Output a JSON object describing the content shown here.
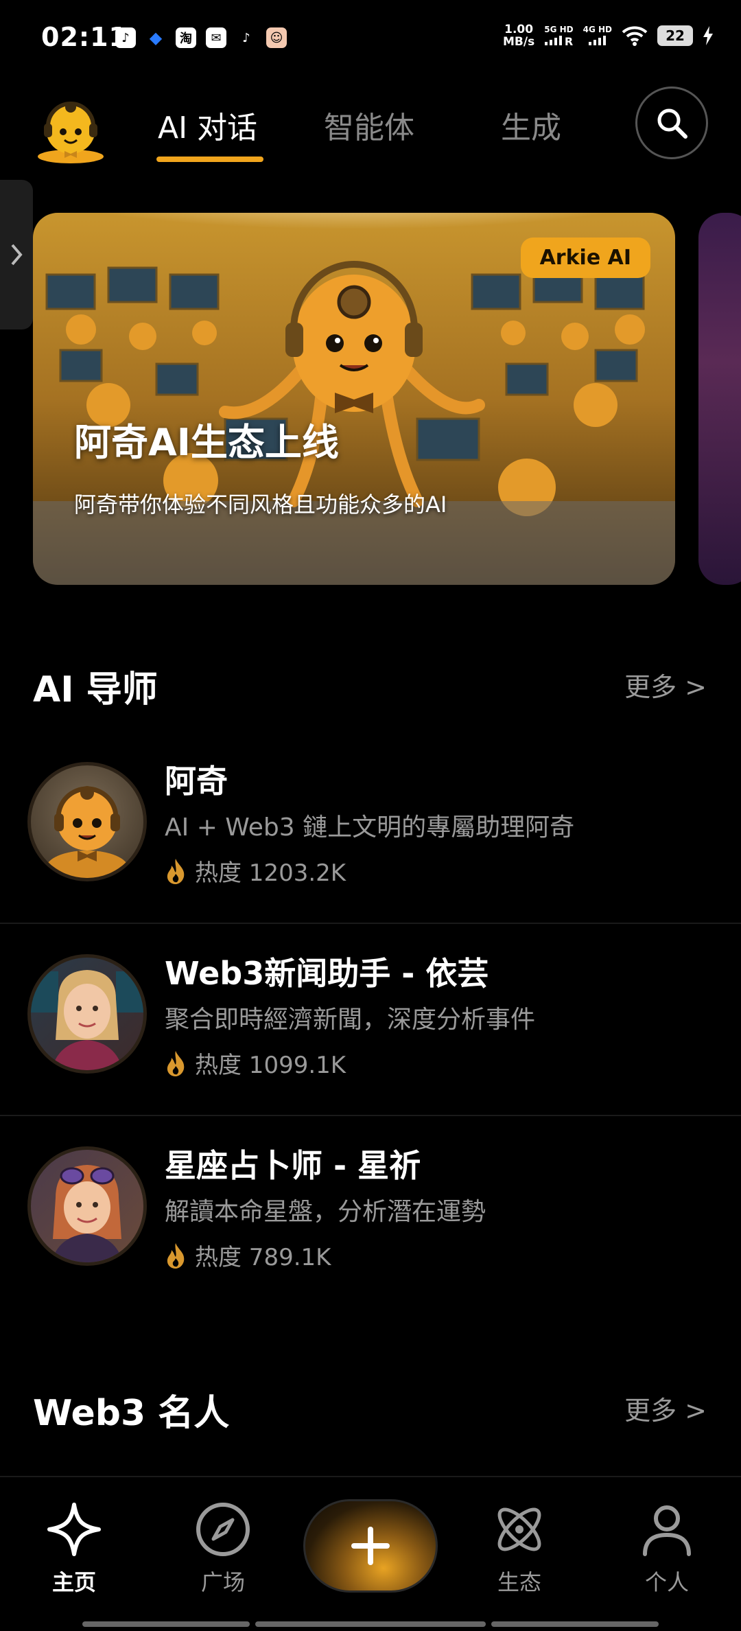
{
  "status_bar": {
    "time": "02:11",
    "net_speed_value": "1.00",
    "net_speed_unit": "MB/s",
    "sim1": "5G HD",
    "sim2": "4G HD",
    "roaming": "R",
    "battery": "22",
    "app_icons": [
      "douyin-icon",
      "app-icon",
      "taobao-icon",
      "mail-icon",
      "tiktok-icon",
      "avatar-icon"
    ],
    "taobao_glyph": "淘"
  },
  "top_nav": {
    "tabs": [
      {
        "label": "AI 对话",
        "active": true
      },
      {
        "label": "智能体",
        "active": false
      },
      {
        "label": "生成",
        "active": false
      }
    ],
    "accent": "#f0a51d"
  },
  "banner": {
    "badge": "Arkie AI",
    "title": "阿奇AI生态上线",
    "subtitle": "阿奇带你体验不同风格且功能众多的AI"
  },
  "sections": {
    "mentors": {
      "title": "AI 导师",
      "more": "更多 >"
    },
    "celebs": {
      "title": "Web3 名人",
      "more": "更多 >"
    }
  },
  "mentors": [
    {
      "name": "阿奇",
      "desc": "AI + Web3 鏈上文明的專屬助理阿奇",
      "heat": "热度 1203.2K"
    },
    {
      "name": "Web3新闻助手 - 依芸",
      "desc": "聚合即時經濟新聞，深度分析事件",
      "heat": "热度 1099.1K"
    },
    {
      "name": "星座占卜师 - 星祈",
      "desc": "解讀本命星盤，分析潛在運勢",
      "heat": "热度 789.1K"
    }
  ],
  "bottom_nav": {
    "home": "主页",
    "square": "广场",
    "eco": "生态",
    "me": "个人"
  }
}
